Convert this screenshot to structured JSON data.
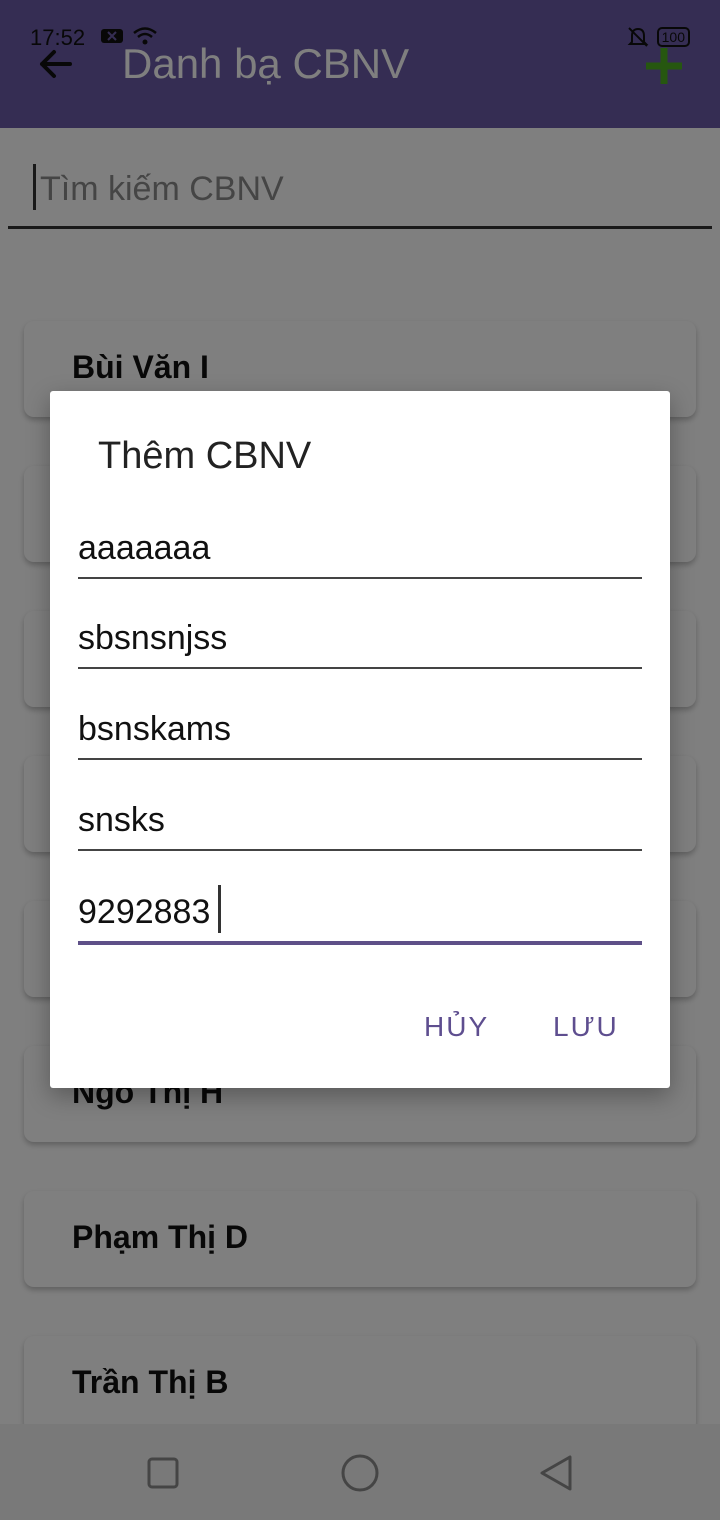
{
  "status_bar": {
    "time": "17:52",
    "battery": "100"
  },
  "appbar": {
    "title": "Danh bạ CBNV"
  },
  "search": {
    "placeholder": "Tìm kiếm CBNV"
  },
  "list": {
    "items": [
      {
        "name": "Bùi Văn I"
      },
      {
        "name": ""
      },
      {
        "name": ""
      },
      {
        "name": ""
      },
      {
        "name": ""
      },
      {
        "name": "Ngo Thị H"
      },
      {
        "name": "Phạm Thị D"
      },
      {
        "name": "Trần Thị B"
      }
    ]
  },
  "dialog": {
    "title": "Thêm CBNV",
    "fields": [
      {
        "value": "aaaaaaa"
      },
      {
        "value": "sbsnsnjss"
      },
      {
        "value": "bsnskams"
      },
      {
        "value": "snsks"
      },
      {
        "value": "9292883"
      }
    ],
    "cancel_label": "HỦY",
    "save_label": "LƯU"
  },
  "colors": {
    "primary": "#6b5aa6",
    "accent": "#5e4e8f",
    "add": "#4caf20"
  },
  "icons": [
    "back-arrow-icon",
    "add-icon",
    "notification-muted-icon",
    "wifi-icon",
    "square-icon",
    "circle-icon",
    "triangle-back-icon"
  ]
}
